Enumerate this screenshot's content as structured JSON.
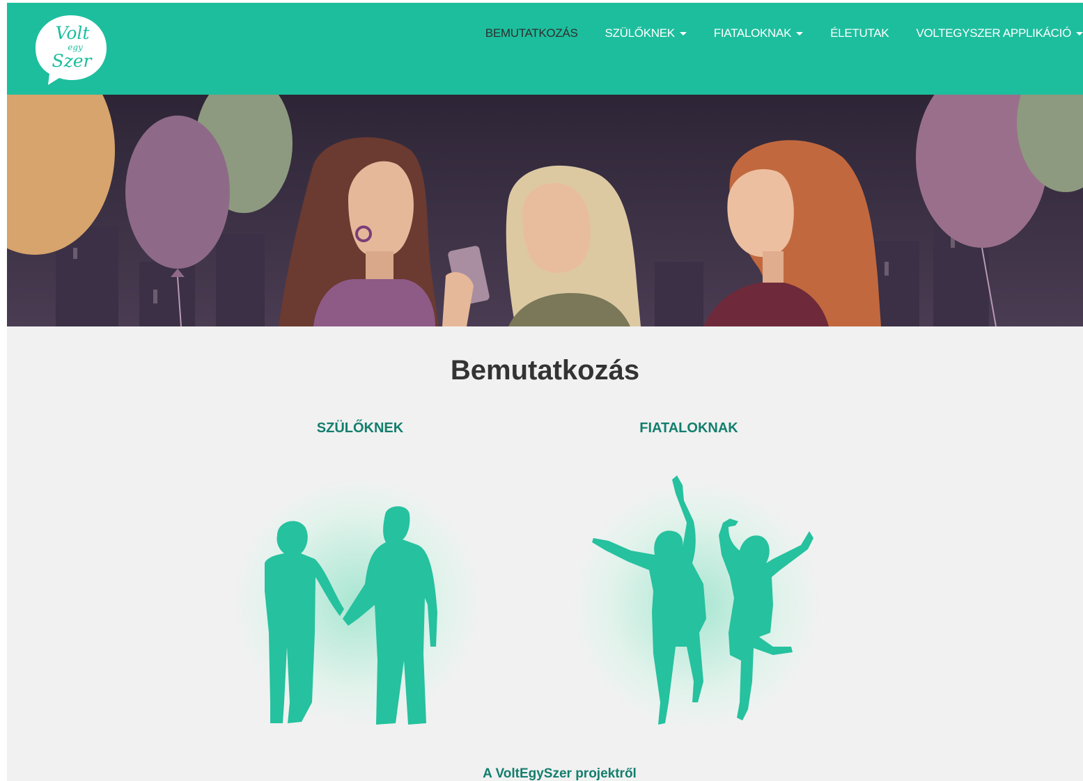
{
  "brand": {
    "logo_line1": "Volt",
    "logo_line2": "egy",
    "logo_line3": "Szer",
    "color": "#1dbe9d"
  },
  "nav": {
    "items": [
      {
        "label": "BEMUTATKOZÁS",
        "active": true,
        "dropdown": false
      },
      {
        "label": "SZÜLŐKNEK",
        "active": false,
        "dropdown": true
      },
      {
        "label": "FIATALOKNAK",
        "active": false,
        "dropdown": true
      },
      {
        "label": "ÉLETUTAK",
        "active": false,
        "dropdown": false
      },
      {
        "label": "VOLTEGYSZER APPLIKÁCIÓ",
        "active": false,
        "dropdown": true
      }
    ]
  },
  "main": {
    "title": "Bemutatkozás",
    "columns": [
      {
        "heading": "SZÜLŐKNEK",
        "image": "parents-silhouette"
      },
      {
        "heading": "FIATALOKNAK",
        "image": "youth-silhouette"
      }
    ],
    "project_link": "A VoltEgySzer projektről"
  },
  "colors": {
    "accent": "#1dbe9d",
    "heading_teal": "#137e6d",
    "title": "#333333",
    "silhouette": "#26c19e"
  }
}
